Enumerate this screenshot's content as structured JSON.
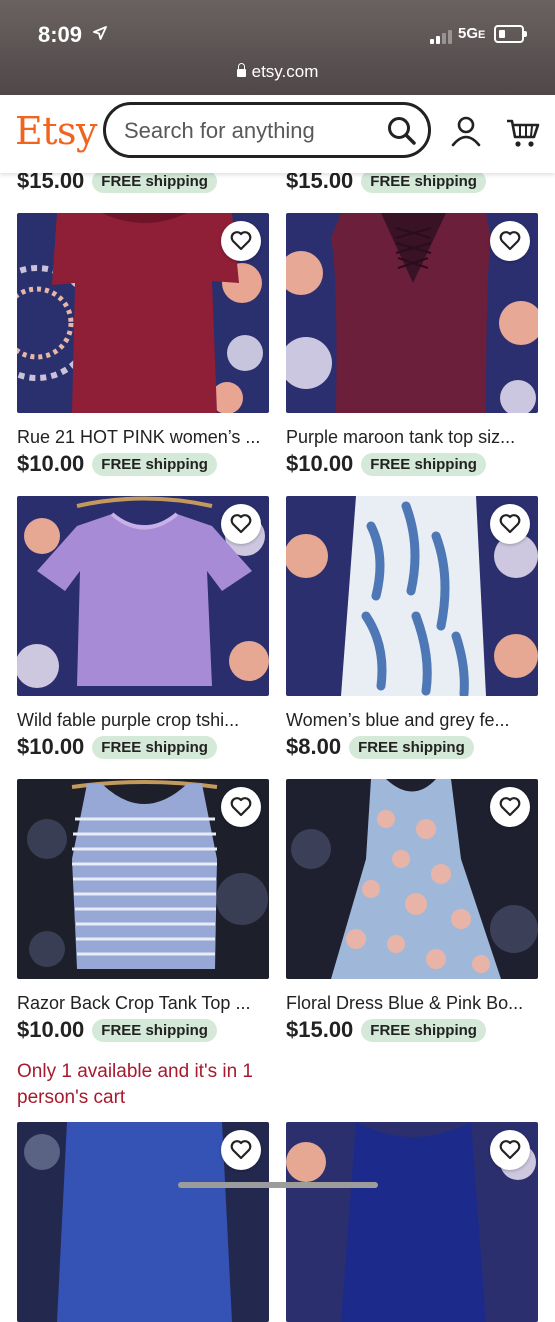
{
  "status": {
    "time": "8:09",
    "network": "5G",
    "network_suffix": "E",
    "url": "etsy.com"
  },
  "header": {
    "logo": "Etsy",
    "search_placeholder": "Search for anything"
  },
  "colors": {
    "brand": "#f1641e",
    "shipping_badge_bg": "#d4e9d7",
    "stock_note": "#a61a2e"
  },
  "top_row": [
    {
      "price": "$15.00",
      "shipping": "FREE shipping"
    },
    {
      "price": "$15.00",
      "shipping": "FREE shipping"
    }
  ],
  "listings": [
    {
      "title": "Rue 21 HOT PINK women’s ...",
      "price": "$10.00",
      "shipping": "FREE shipping",
      "image": "maroon-long-sleeve-dress"
    },
    {
      "title": "Purple maroon tank top siz...",
      "price": "$10.00",
      "shipping": "FREE shipping",
      "image": "maroon-lace-up-tank"
    },
    {
      "title": "Wild fable purple crop tshi...",
      "price": "$10.00",
      "shipping": "FREE shipping",
      "image": "purple-crop-tee"
    },
    {
      "title": "Women’s blue and grey fe...",
      "price": "$8.00",
      "shipping": "FREE shipping",
      "image": "blue-feather-print"
    },
    {
      "title": "Razor Back Crop Tank Top ...",
      "price": "$10.00",
      "shipping": "FREE shipping",
      "image": "blue-striped-tank",
      "note": "Only 1 available and it's in 1 person's cart"
    },
    {
      "title": "Floral Dress Blue & Pink Bo...",
      "price": "$15.00",
      "shipping": "FREE shipping",
      "image": "floral-tiered-dress"
    },
    {
      "image": "blue-shirt"
    },
    {
      "image": "navy-dress"
    }
  ]
}
